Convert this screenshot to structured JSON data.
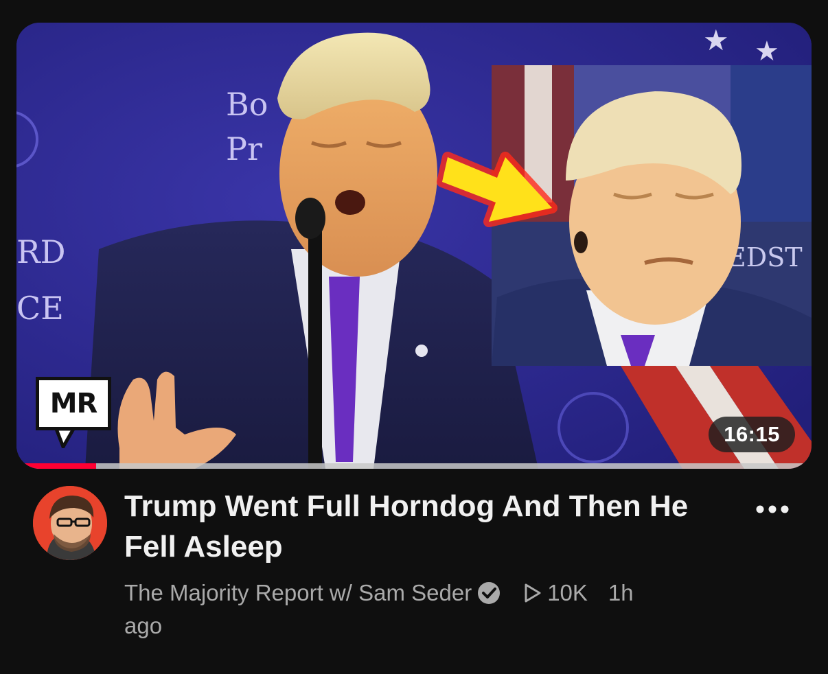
{
  "video": {
    "title": "Trump Went Full Horndog And Then He Fell Asleep",
    "duration": "16:15",
    "watch_progress": 0.1,
    "channel_name": "The Majority Report w/ Sam Seder",
    "channel_verified": true,
    "views": "10K",
    "age_line1": "1h",
    "age_line2": "ago",
    "thumbnail_badge": "MR",
    "thumbnail_backdrop_text_left": [
      "RD",
      "CE"
    ],
    "thumbnail_backdrop_text_center": [
      "Bo",
      "Pr"
    ],
    "thumbnail_inset_text": "EDST"
  },
  "icons": {
    "verified": "verified-check-icon",
    "views": "play-triangle-icon",
    "menu": "more-dots-icon"
  },
  "colors": {
    "background": "#0f0f0f",
    "title": "#f1f1f1",
    "meta": "#aaaaaa",
    "progress": "#ff0033",
    "avatar_bg": "#e8432c",
    "arrow": "#ffe11a"
  }
}
